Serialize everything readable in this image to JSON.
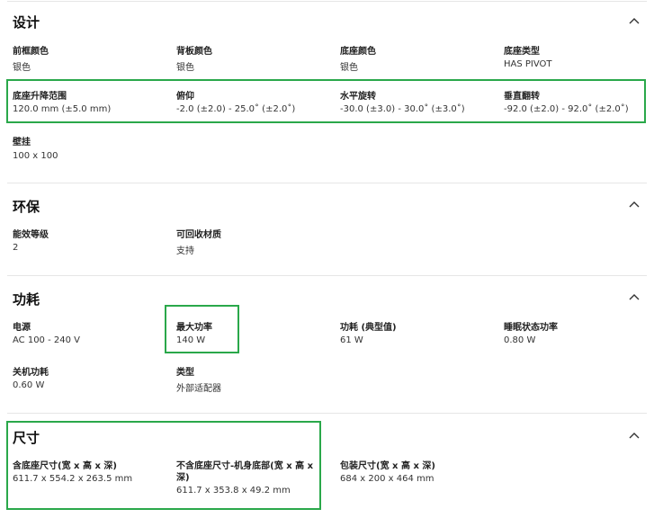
{
  "sections": {
    "design": {
      "title": "设计",
      "items": [
        {
          "label": "前框颜色",
          "value": "银色"
        },
        {
          "label": "背板颜色",
          "value": "银色"
        },
        {
          "label": "底座颜色",
          "value": "银色"
        },
        {
          "label": "底座类型",
          "value": "HAS PIVOT"
        },
        {
          "label": "底座升降范围",
          "value": "120.0 mm (±5.0 mm)"
        },
        {
          "label": "俯仰",
          "value": "-2.0 (±2.0) - 25.0˚ (±2.0˚)"
        },
        {
          "label": "水平旋转",
          "value": "-30.0 (±3.0) - 30.0˚ (±3.0˚)"
        },
        {
          "label": "垂直翻转",
          "value": "-92.0 (±2.0) - 92.0˚ (±2.0˚)"
        },
        {
          "label": "壁挂",
          "value": "100 x 100"
        }
      ]
    },
    "environment": {
      "title": "环保",
      "items": [
        {
          "label": "能效等级",
          "value": "2"
        },
        {
          "label": "可回收材质",
          "value": "支持"
        }
      ]
    },
    "power": {
      "title": "功耗",
      "items": [
        {
          "label": "电源",
          "value": "AC 100 - 240 V"
        },
        {
          "label": "最大功率",
          "value": "140 W"
        },
        {
          "label": "功耗 (典型值)",
          "value": "61 W"
        },
        {
          "label": "睡眠状态功率",
          "value": "0.80 W"
        },
        {
          "label": "关机功耗",
          "value": "0.60 W"
        },
        {
          "label": "类型",
          "value": "外部适配器"
        }
      ]
    },
    "dimensions": {
      "title": "尺寸",
      "items": [
        {
          "label": "含底座尺寸(宽 x 高 x 深)",
          "value": "611.7 x 554.2 x 263.5 mm"
        },
        {
          "label": "不含底座尺寸-机身底部(宽 x 高 x 深)",
          "label_line1": "不含底座尺寸-机身底部(宽 x 高 x",
          "label_line2": "深)",
          "value": "611.7 x 353.8 x 49.2 mm"
        },
        {
          "label": "包装尺寸(宽 x 高 x 深)",
          "value": "684 x 200 x 464 mm"
        }
      ]
    }
  },
  "colors": {
    "highlight": "#2aa84a",
    "divider": "#e6e6e6"
  },
  "icons": {
    "collapse": "chevron-up-icon"
  }
}
